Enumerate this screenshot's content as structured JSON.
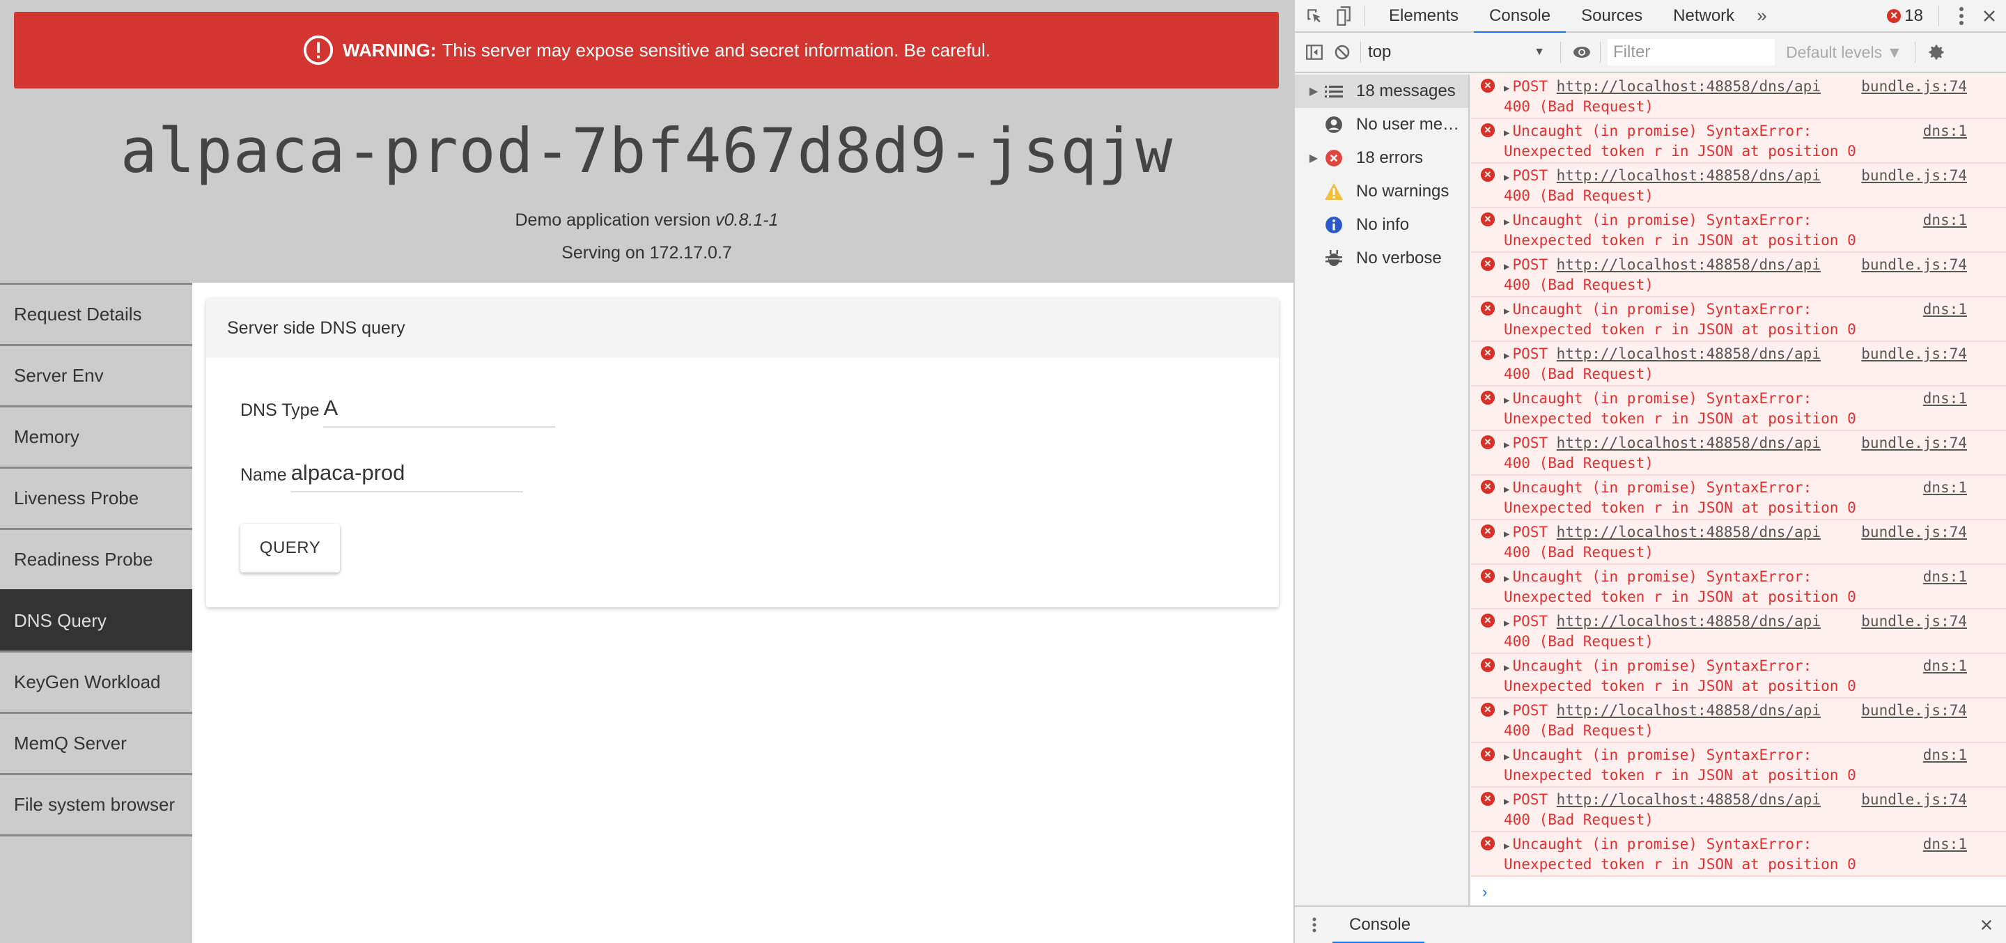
{
  "app": {
    "warning": {
      "icon": "exclamation-circle-icon",
      "bold": "WARNING:",
      "text": "This server may expose sensitive and secret information. Be careful.",
      "color": "#d33631"
    },
    "hostname": "alpaca-prod-7bf467d8d9-jsqjw",
    "version_prefix": "Demo application version",
    "version": "v0.8.1-1",
    "serving": "Serving on 172.17.0.7",
    "nav": [
      {
        "label": "Request Details",
        "active": false
      },
      {
        "label": "Server Env",
        "active": false
      },
      {
        "label": "Memory",
        "active": false
      },
      {
        "label": "Liveness Probe",
        "active": false
      },
      {
        "label": "Readiness Probe",
        "active": false
      },
      {
        "label": "DNS Query",
        "active": true
      },
      {
        "label": "KeyGen Workload",
        "active": false
      },
      {
        "label": "MemQ Server",
        "active": false
      },
      {
        "label": "File system browser",
        "active": false
      }
    ],
    "card": {
      "title": "Server side DNS query",
      "dns_type_label": "DNS Type",
      "dns_type_value": "A",
      "name_label": "Name",
      "name_value": "alpaca-prod",
      "query_button": "QUERY"
    }
  },
  "devtools": {
    "tabs": [
      "Elements",
      "Console",
      "Sources",
      "Network"
    ],
    "active_tab": "Console",
    "more": "»",
    "error_count": "18",
    "context": "top",
    "filter_placeholder": "Filter",
    "levels": "Default levels ▼",
    "sidebar": [
      {
        "label": "18 messages",
        "icon": "list-icon",
        "expandable": true,
        "selected": true
      },
      {
        "label": "No user me…",
        "icon": "user-icon",
        "expandable": false,
        "selected": false
      },
      {
        "label": "18 errors",
        "icon": "error-icon",
        "expandable": true,
        "selected": false
      },
      {
        "label": "No warnings",
        "icon": "warning-icon",
        "expandable": false,
        "selected": false
      },
      {
        "label": "No info",
        "icon": "info-icon",
        "expandable": false,
        "selected": false
      },
      {
        "label": "No verbose",
        "icon": "bug-icon",
        "expandable": false,
        "selected": false
      }
    ],
    "messages": [
      {
        "type": "post",
        "method": "POST",
        "url": "http://localhost:48858/dns/api",
        "line2": "400 (Bad Request)",
        "source": "bundle.js:74"
      },
      {
        "type": "error",
        "line1": "Uncaught (in promise) SyntaxError:",
        "line2": "Unexpected token r in JSON at position 0",
        "source": "dns:1"
      },
      {
        "type": "post",
        "method": "POST",
        "url": "http://localhost:48858/dns/api",
        "line2": "400 (Bad Request)",
        "source": "bundle.js:74"
      },
      {
        "type": "error",
        "line1": "Uncaught (in promise) SyntaxError:",
        "line2": "Unexpected token r in JSON at position 0",
        "source": "dns:1"
      },
      {
        "type": "post",
        "method": "POST",
        "url": "http://localhost:48858/dns/api",
        "line2": "400 (Bad Request)",
        "source": "bundle.js:74"
      },
      {
        "type": "error",
        "line1": "Uncaught (in promise) SyntaxError:",
        "line2": "Unexpected token r in JSON at position 0",
        "source": "dns:1"
      },
      {
        "type": "post",
        "method": "POST",
        "url": "http://localhost:48858/dns/api",
        "line2": "400 (Bad Request)",
        "source": "bundle.js:74"
      },
      {
        "type": "error",
        "line1": "Uncaught (in promise) SyntaxError:",
        "line2": "Unexpected token r in JSON at position 0",
        "source": "dns:1"
      },
      {
        "type": "post",
        "method": "POST",
        "url": "http://localhost:48858/dns/api",
        "line2": "400 (Bad Request)",
        "source": "bundle.js:74"
      },
      {
        "type": "error",
        "line1": "Uncaught (in promise) SyntaxError:",
        "line2": "Unexpected token r in JSON at position 0",
        "source": "dns:1"
      },
      {
        "type": "post",
        "method": "POST",
        "url": "http://localhost:48858/dns/api",
        "line2": "400 (Bad Request)",
        "source": "bundle.js:74"
      },
      {
        "type": "error",
        "line1": "Uncaught (in promise) SyntaxError:",
        "line2": "Unexpected token r in JSON at position 0",
        "source": "dns:1"
      },
      {
        "type": "post",
        "method": "POST",
        "url": "http://localhost:48858/dns/api",
        "line2": "400 (Bad Request)",
        "source": "bundle.js:74"
      },
      {
        "type": "error",
        "line1": "Uncaught (in promise) SyntaxError:",
        "line2": "Unexpected token r in JSON at position 0",
        "source": "dns:1"
      },
      {
        "type": "post",
        "method": "POST",
        "url": "http://localhost:48858/dns/api",
        "line2": "400 (Bad Request)",
        "source": "bundle.js:74"
      },
      {
        "type": "error",
        "line1": "Uncaught (in promise) SyntaxError:",
        "line2": "Unexpected token r in JSON at position 0",
        "source": "dns:1"
      },
      {
        "type": "post",
        "method": "POST",
        "url": "http://localhost:48858/dns/api",
        "line2": "400 (Bad Request)",
        "source": "bundle.js:74"
      },
      {
        "type": "error",
        "line1": "Uncaught (in promise) SyntaxError:",
        "line2": "Unexpected token r in JSON at position 0",
        "source": "dns:1"
      }
    ],
    "prompt": "›",
    "drawer_tab": "Console"
  }
}
